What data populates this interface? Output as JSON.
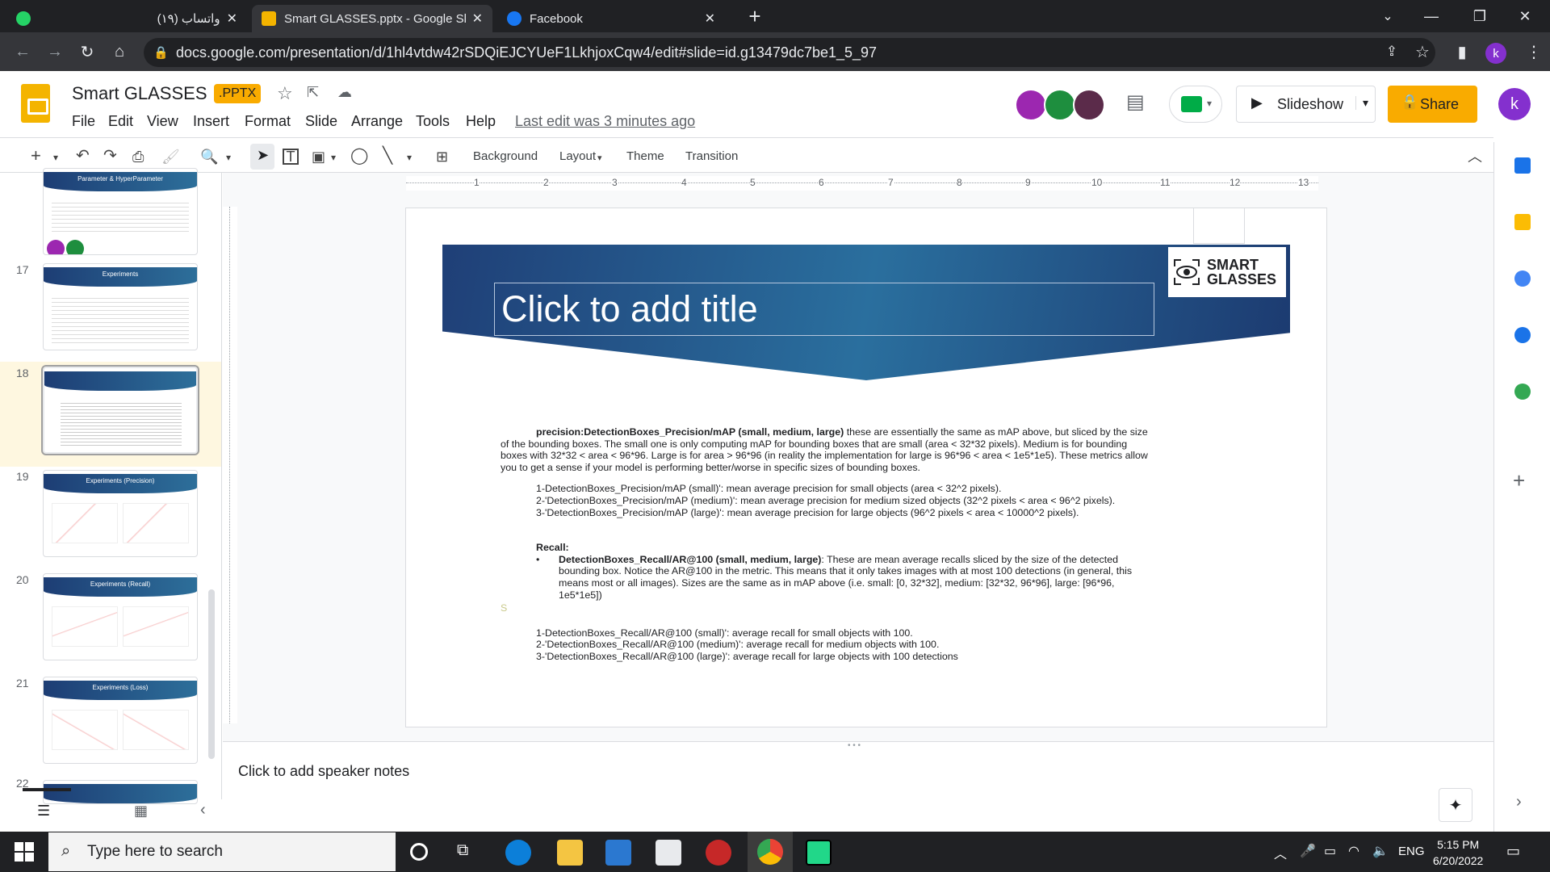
{
  "browser": {
    "tabs": [
      {
        "title": "(١٩) واتساب",
        "favicon_color": "#25d366"
      },
      {
        "title": "Smart GLASSES.pptx - Google Sli",
        "favicon_color": "#f4b400"
      },
      {
        "title": "Facebook",
        "favicon_color": "#1877f2"
      }
    ],
    "url": "docs.google.com/presentation/d/1hl4vtdw42rSDQiEJCYUeF1LkhjoxCqw4/edit#slide=id.g13479dc7be1_5_97",
    "avatar_letter": "k"
  },
  "docs": {
    "title": "Smart GLASSES",
    "badge": ".PPTX",
    "menu": [
      "File",
      "Edit",
      "View",
      "Insert",
      "Format",
      "Slide",
      "Arrange",
      "Tools",
      "Help"
    ],
    "last_edit": "Last edit was 3 minutes ago",
    "slideshow_label": "Slideshow",
    "share_label": "Share",
    "user_letter": "k"
  },
  "toolbar": {
    "background_label": "Background",
    "layout_label": "Layout",
    "theme_label": "Theme",
    "transition_label": "Transition"
  },
  "ruler_numbers": [
    "1",
    "2",
    "3",
    "4",
    "5",
    "6",
    "7",
    "8",
    "9",
    "10",
    "11",
    "12",
    "13"
  ],
  "filmstrip": {
    "slides": [
      {
        "num": "",
        "title": "Parameter & HyperParameter"
      },
      {
        "num": "17",
        "title": "Experiments"
      },
      {
        "num": "18",
        "title": ""
      },
      {
        "num": "19",
        "title": "Experiments (Precision)"
      },
      {
        "num": "20",
        "title": "Experiments (Recall)"
      },
      {
        "num": "21",
        "title": "Experiments (Loss)"
      },
      {
        "num": "22",
        "title": ""
      }
    ]
  },
  "slide": {
    "title_placeholder": "Click to add title",
    "logo_text_1": "SMART",
    "logo_text_2": "GLASSES",
    "precision_bold": "precision:DetectionBoxes_Precision/mAP (small, medium, large)",
    "precision_text": " these are essentially the same as mAP above, but sliced by the size of the bounding boxes. The small one is only computing mAP for bounding boxes that are small (area < 32*32 pixels). Medium is for bounding boxes with 32*32 < area < 96*96. Large is for area > 96*96 (in reality the implementation for large is 96*96 < area < 1e5*1e5). These metrics allow you to get a sense if your model is performing better/worse in specific sizes of bounding boxes.",
    "precision_items": [
      "1-DetectionBoxes_Precision/mAP (small)': mean average precision for small objects (area < 32^2 pixels).",
      "2-'DetectionBoxes_Precision/mAP (medium)': mean average precision for medium sized objects (32^2 pixels < area < 96^2 pixels).",
      "3-'DetectionBoxes_Precision/mAP (large)': mean average precision for large objects (96^2 pixels < area < 10000^2 pixels)."
    ],
    "recall_heading": "Recall:",
    "recall_bold": "DetectionBoxes_Recall/AR@100 (small, medium, large)",
    "recall_text": ": These are mean average recalls sliced by the size of the detected bounding box. Notice the AR@100 in the metric. This means that it only takes images with at most 100 detections (in general, this means most or all images). Sizes are the same as in mAP above (i.e. small: [0, 32*32], medium: [32*32, 96*96], large: [96*96, 1e5*1e5])",
    "stray_char": "S",
    "recall_items": [
      "1-DetectionBoxes_Recall/AR@100 (small)': average recall for small objects with 100.",
      "2-'DetectionBoxes_Recall/AR@100 (medium)': average recall for medium objects with 100.",
      "3-'DetectionBoxes_Recall/AR@100 (large)': average recall for large objects with 100 detections"
    ]
  },
  "notes_placeholder": "Click to add speaker notes",
  "taskbar": {
    "search_placeholder": "Type here to search",
    "lang": "ENG",
    "time": "5:15 PM",
    "date": "6/20/2022"
  }
}
